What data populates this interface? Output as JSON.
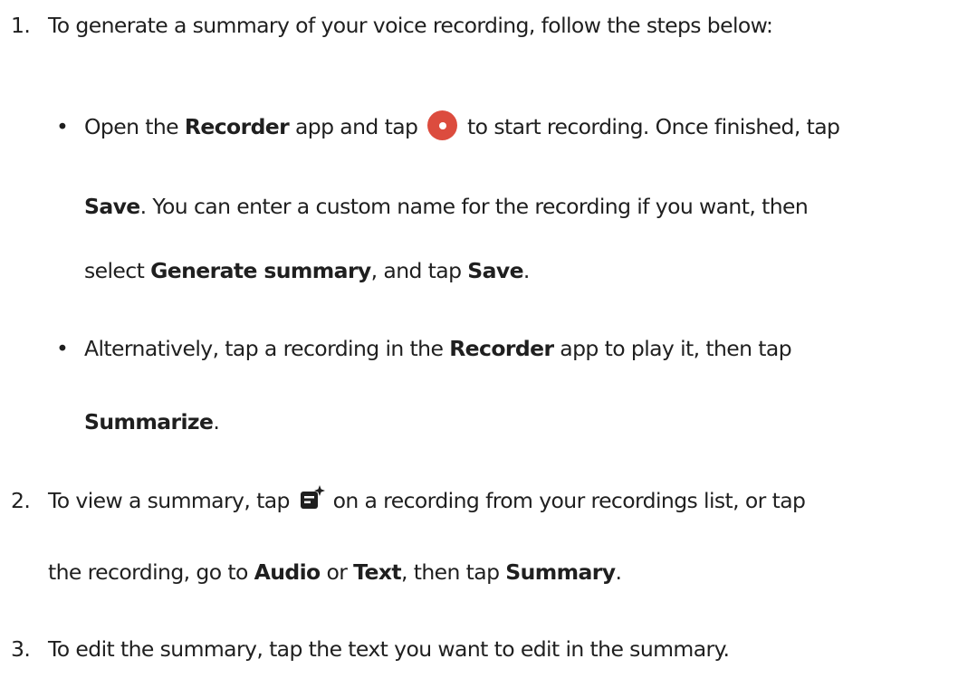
{
  "steps": [
    {
      "number": "1.",
      "text": "To generate a summary of your voice recording, follow the steps below:",
      "bullets": [
        {
          "bullet": "•",
          "l1_a": "Open the ",
          "l1_b": "Recorder",
          "l1_c": " app and tap ",
          "l1_icon": "record-icon",
          "l1_d": " to start recording. Once finished, tap",
          "l2_a": "Save",
          "l2_b": ". You can enter a custom name for the recording if you want, then",
          "l3_a": "select ",
          "l3_b": "Generate summary",
          "l3_c": ", and tap ",
          "l3_d": "Save",
          "l3_e": "."
        },
        {
          "bullet": "•",
          "l1_a": "Alternatively, tap a recording in the ",
          "l1_b": "Recorder",
          "l1_c": " app to play it, then tap",
          "l2_a": "Summarize",
          "l2_b": "."
        }
      ]
    },
    {
      "number": "2.",
      "l1_a": "To view a summary, tap ",
      "l1_icon": "summary-icon",
      "l1_b": " on a recording from your recordings list, or tap",
      "l2_a": "the recording, go to ",
      "l2_b": "Audio",
      "l2_c": " or ",
      "l2_d": "Text",
      "l2_e": ", then tap ",
      "l2_f": "Summary",
      "l2_g": "."
    },
    {
      "number": "3.",
      "text": "To edit the summary, tap the text you want to edit in the summary."
    }
  ],
  "colors": {
    "text": "#1f1f1f",
    "record_button": "#dc4c3e"
  }
}
